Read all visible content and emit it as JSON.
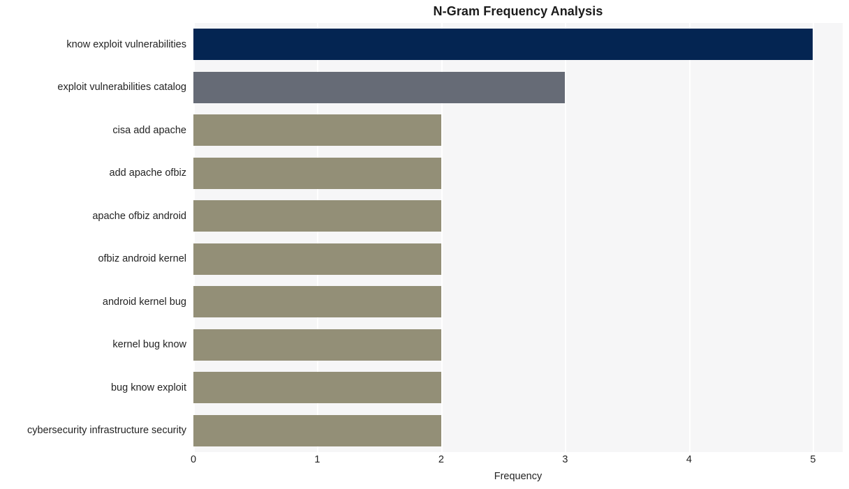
{
  "chart_data": {
    "type": "bar",
    "orientation": "horizontal",
    "title": "N-Gram Frequency Analysis",
    "xlabel": "Frequency",
    "ylabel": "",
    "xlim": [
      0,
      5.24
    ],
    "xticks": [
      "0",
      "1",
      "2",
      "3",
      "4",
      "5"
    ],
    "xtick_values": [
      0,
      1,
      2,
      3,
      4,
      5
    ],
    "grid": "vertical-white-on-light-gray",
    "legend": "none",
    "categories": [
      "know exploit vulnerabilities",
      "exploit vulnerabilities catalog",
      "cisa add apache",
      "add apache ofbiz",
      "apache ofbiz android",
      "ofbiz android kernel",
      "android kernel bug",
      "kernel bug know",
      "bug know exploit",
      "cybersecurity infrastructure security"
    ],
    "values": [
      5,
      3,
      2,
      2,
      2,
      2,
      2,
      2,
      2,
      2
    ],
    "bar_colors": [
      "#042552",
      "#666b76",
      "#938f77",
      "#938f77",
      "#938f77",
      "#938f77",
      "#938f77",
      "#938f77",
      "#938f77",
      "#938f77"
    ]
  },
  "colors": {
    "plot_background": "#f6f6f7",
    "figure_background": "#ffffff",
    "gridline": "#ffffff",
    "text": "#232323",
    "title_text": "#1a1a1a",
    "accent_primary": "#042552",
    "accent_secondary": "#666b76",
    "accent_tertiary": "#938f77"
  }
}
